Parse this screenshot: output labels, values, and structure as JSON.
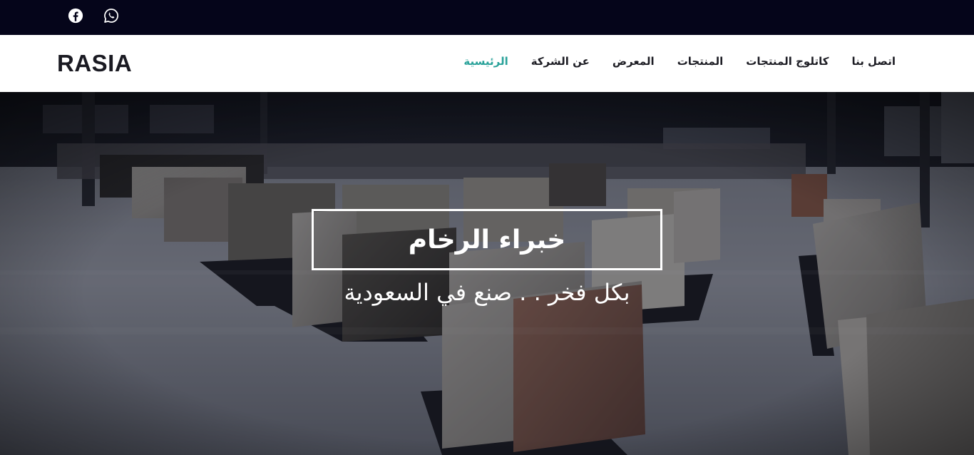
{
  "topbar": {
    "social": [
      {
        "icon": "facebook-icon"
      },
      {
        "icon": "whatsapp-icon"
      }
    ]
  },
  "navbar": {
    "brand": "RASIA",
    "menu": [
      {
        "label": "الرئيسية",
        "active": true
      },
      {
        "label": "عن الشركة",
        "active": false
      },
      {
        "label": "المعرض",
        "active": false
      },
      {
        "label": "المنتجات",
        "active": false
      },
      {
        "label": "كاتلوج المنتجات",
        "active": false
      },
      {
        "label": "اتصل بنا",
        "active": false
      }
    ]
  },
  "hero": {
    "title": "خبراء الرخام",
    "subtitle": "بكل فخر . . صنع في السعودية"
  },
  "colors": {
    "topbar": "#05051a",
    "accent": "#2aa29a",
    "brand_text": "#1a1a22"
  }
}
